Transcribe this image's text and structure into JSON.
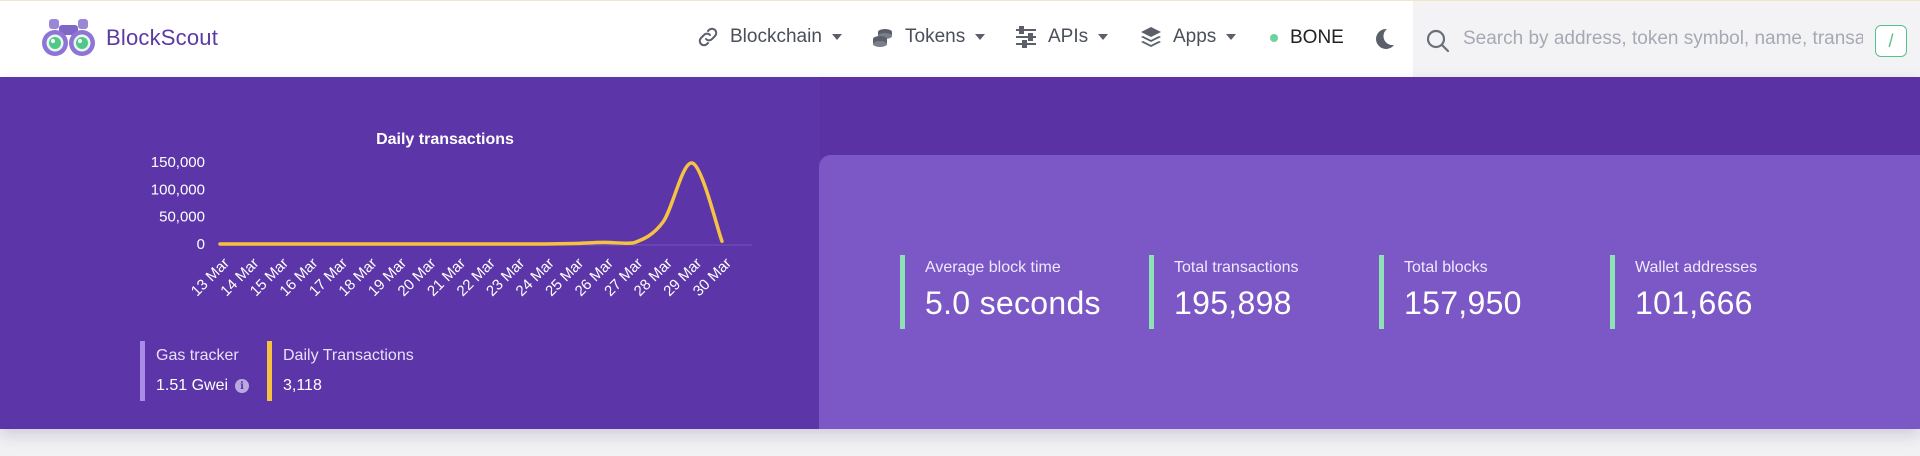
{
  "header": {
    "brand": "BlockScout",
    "nav": [
      {
        "label": "Blockchain",
        "icon": "link-icon"
      },
      {
        "label": "Tokens",
        "icon": "coins-icon"
      },
      {
        "label": "APIs",
        "icon": "sliders-icon"
      },
      {
        "label": "Apps",
        "icon": "layers-icon"
      }
    ],
    "network": "BONE",
    "search_placeholder": "Search by address, token symbol, name, transaction hash, or block number",
    "search_shortcut": "/"
  },
  "stats_small": {
    "gas_label": "Gas tracker",
    "gas_value": "1.51 Gwei",
    "daily_label": "Daily Transactions",
    "daily_value": "3,118"
  },
  "stats": [
    {
      "label": "Average block time",
      "value": "5.0 seconds"
    },
    {
      "label": "Total transactions",
      "value": "195,898"
    },
    {
      "label": "Total blocks",
      "value": "157,950"
    },
    {
      "label": "Wallet addresses",
      "value": "101,666"
    }
  ],
  "colors": {
    "accent_purple": "#5c36a8",
    "panel_purple": "#7b58c5",
    "line_yellow": "#f5c242",
    "stat_border_green": "#8ee0b6"
  },
  "chart_data": {
    "type": "line",
    "title": "Daily transactions",
    "categories": [
      "13 Mar",
      "14 Mar",
      "15 Mar",
      "16 Mar",
      "17 Mar",
      "18 Mar",
      "19 Mar",
      "20 Mar",
      "21 Mar",
      "22 Mar",
      "23 Mar",
      "24 Mar",
      "25 Mar",
      "26 Mar",
      "27 Mar",
      "28 Mar",
      "29 Mar",
      "30 Mar"
    ],
    "values": [
      0,
      0,
      0,
      0,
      0,
      0,
      0,
      0,
      0,
      0,
      0,
      0,
      1000,
      3000,
      2000,
      40000,
      148000,
      5000
    ],
    "yticks": [
      "0",
      "50,000",
      "100,000",
      "150,000"
    ],
    "ylim": [
      0,
      150000
    ]
  }
}
